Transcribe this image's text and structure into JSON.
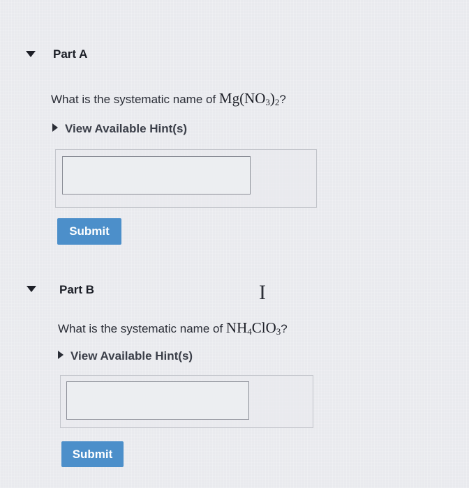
{
  "parts": [
    {
      "title": "Part A",
      "question_prefix": "What is the systematic name of ",
      "formula": {
        "main": "Mg(NO",
        "sub1": "3",
        "close": ")",
        "sub2": "2"
      },
      "question_suffix": "?",
      "hint_label": "View Available Hint(s)",
      "answer_value": "",
      "submit_label": "Submit"
    },
    {
      "title": "Part B",
      "question_prefix": "What is the systematic name of ",
      "formula": {
        "main": "NH",
        "sub1": "4",
        "mid": "ClO",
        "sub2": "3"
      },
      "question_suffix": "?",
      "hint_label": "View Available Hint(s)",
      "answer_value": "",
      "submit_label": "Submit"
    }
  ],
  "icons": {
    "expand": "caret-down-icon",
    "hint": "caret-right-icon",
    "cursor": "text-cursor-icon"
  },
  "colors": {
    "submit_bg": "#4c8fca",
    "background": "#e9eaee"
  }
}
